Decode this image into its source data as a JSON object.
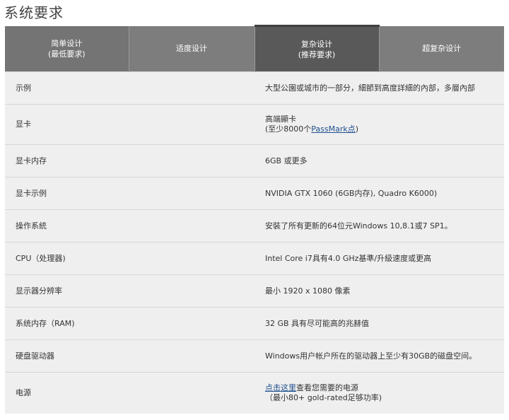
{
  "page_title": "系统要求",
  "headers": {
    "col1_line1": "简单设计",
    "col1_line2": "(最低要求)",
    "col2": "适度设计",
    "col3_line1": "复杂设计",
    "col3_line2": "(推荐要求)",
    "col4": "超复杂设计"
  },
  "rows": {
    "example": {
      "label": "示例",
      "value": "大型公園或城市的一部分，細節到高度詳細的內部，多層內部"
    },
    "gpu": {
      "label": "显卡",
      "value_line1": "高端顯卡",
      "value_line2_prefix": "(至少8000个",
      "value_line2_link": "PassMark点",
      "value_line2_suffix": ")"
    },
    "gpu_mem": {
      "label": "显卡内存",
      "value": "6GB 或更多"
    },
    "gpu_example": {
      "label": "显卡示例",
      "value": "NVIDIA GTX 1060 (6GB内存), Quadro K6000)"
    },
    "os": {
      "label": "操作系統",
      "value": "安裝了所有更新的64位元Windows 10,8.1或7 SP1。"
    },
    "cpu": {
      "label": "CPU（处理器)",
      "value": "Intel Core i7具有4.0 GHz基準/升級速度或更高"
    },
    "resolution": {
      "label": "显示器分辨率",
      "value": "最小 1920 x 1080 像素"
    },
    "ram": {
      "label": "系统内存（RAM)",
      "value": "32 GB 具有尽可能高的兆赫值"
    },
    "disk": {
      "label": "硬盘驱动器",
      "value": "Windows用户帐户所在的驱动器上至少有30GB的磁盘空间。"
    },
    "power": {
      "label": "电源",
      "value_link": "点击这里",
      "value_line1_suffix": "查看您需要的电源",
      "value_line2": "（最小80+ gold-rated足够功率)"
    }
  }
}
